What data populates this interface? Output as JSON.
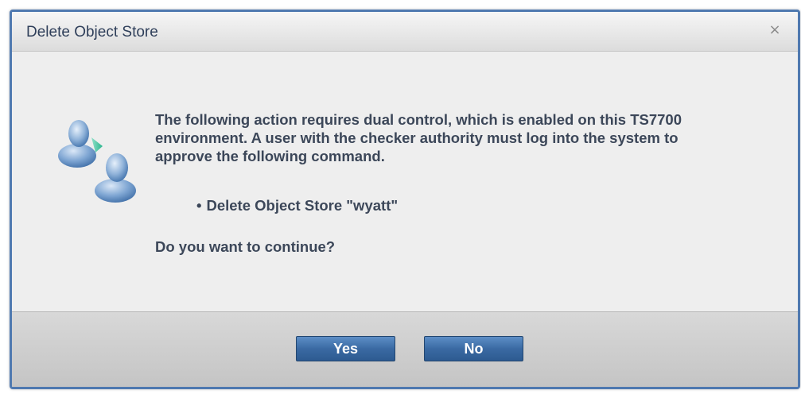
{
  "dialog": {
    "title": "Delete Object Store",
    "close_label": "×",
    "icon": "dual-user-icon",
    "message": "The following action requires dual control, which is enabled on this TS7700 environment. A user with the checker authority must log into the system to approve the following command.",
    "bullet_marker": "•",
    "command_item": "Delete Object Store \"wyatt\"",
    "question": "Do you want to continue?",
    "buttons": {
      "yes": "Yes",
      "no": "No"
    }
  },
  "colors": {
    "border": "#4f79b0",
    "button": "#3a6aa3",
    "text": "#3c4759"
  }
}
